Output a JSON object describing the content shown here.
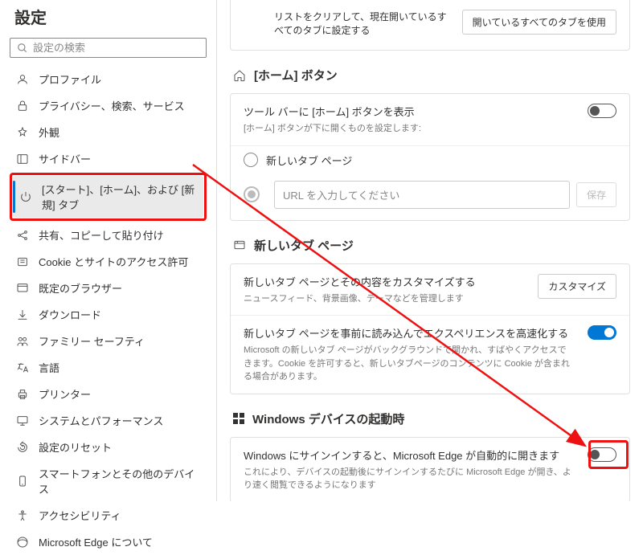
{
  "sidebar": {
    "title": "設定",
    "search_placeholder": "設定の検索",
    "items": [
      {
        "label": "プロファイル"
      },
      {
        "label": "プライバシー、検索、サービス"
      },
      {
        "label": "外観"
      },
      {
        "label": "サイドバー"
      },
      {
        "label": "[スタート]、[ホーム]、および [新規] タブ"
      },
      {
        "label": "共有、コピーして貼り付け"
      },
      {
        "label": "Cookie とサイトのアクセス許可"
      },
      {
        "label": "既定のブラウザー"
      },
      {
        "label": "ダウンロード"
      },
      {
        "label": "ファミリー セーフティ"
      },
      {
        "label": "言語"
      },
      {
        "label": "プリンター"
      },
      {
        "label": "システムとパフォーマンス"
      },
      {
        "label": "設定のリセット"
      },
      {
        "label": "スマートフォンとその他のデバイス"
      },
      {
        "label": "アクセシビリティ"
      },
      {
        "label": "Microsoft Edge について"
      }
    ]
  },
  "top": {
    "desc": "リストをクリアして、現在開いているすべてのタブに設定する",
    "button": "開いているすべてのタブを使用"
  },
  "home": {
    "section": "[ホーム] ボタン",
    "toggle_label": "ツール バーに [ホーム] ボタンを表示",
    "toggle_sub": "[ホーム] ボタンが下に開くものを設定します:",
    "radio1": "新しいタブ ページ",
    "url_placeholder": "URL を入力してください",
    "save": "保存"
  },
  "newtab": {
    "section": "新しいタブ ページ",
    "row1_title": "新しいタブ ページとその内容をカスタマイズする",
    "row1_sub": "ニュースフィード、背景画像、テーマなどを管理します",
    "row1_btn": "カスタマイズ",
    "row2_title": "新しいタブ ページを事前に読み込んでエクスペリエンスを高速化する",
    "row2_sub": "Microsoft の新しいタブ ページがバックグラウンドで開かれ、すばやくアクセスできます。Cookie を許可すると、新しいタブページのコンテンツに Cookie が含まれる場合があります。"
  },
  "windev": {
    "section": "Windows デバイスの起動時",
    "row_title": "Windows にサインインすると、Microsoft Edge が自動的に開きます",
    "row_sub": "これにより、デバイスの起動後にサインインするたびに Microsoft Edge が開き、より速く閲覧できるようになります"
  }
}
